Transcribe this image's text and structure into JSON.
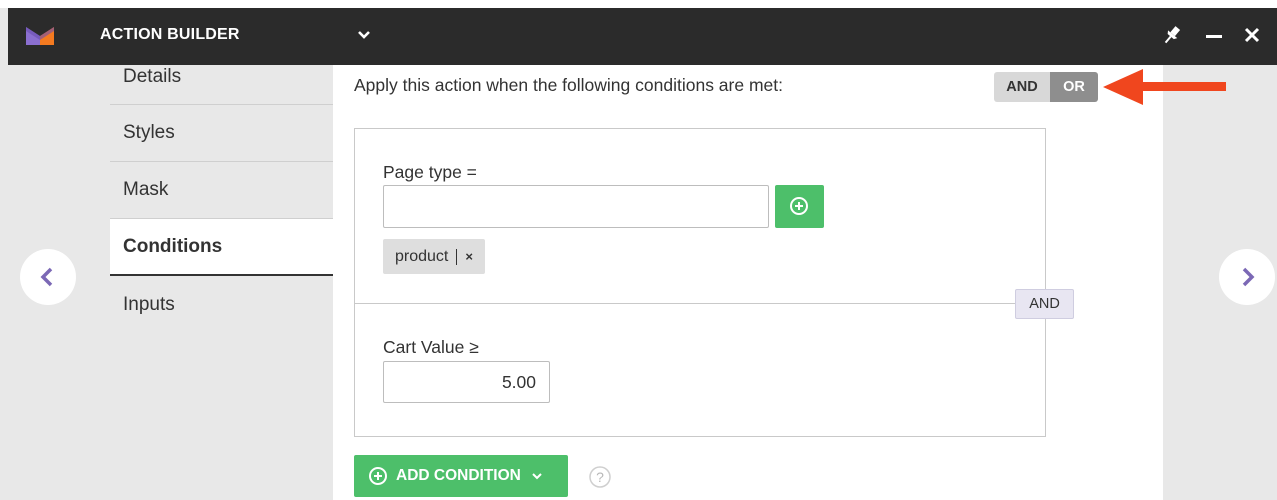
{
  "window": {
    "title": "ACTION BUILDER",
    "brand_color": "#8b6fd0",
    "accent_color": "#f47a20"
  },
  "icons": {
    "logo": "brand-logo",
    "title_menu": "chevron-down-icon",
    "pin": "pin-icon",
    "minimize": "minimize-icon",
    "close": "close-icon",
    "prev": "chevron-left-icon",
    "next": "chevron-right-icon",
    "add": "plus-circle-icon",
    "help": "help-icon"
  },
  "sidebar": {
    "items": [
      {
        "label": "Details",
        "active": false
      },
      {
        "label": "Styles",
        "active": false
      },
      {
        "label": "Mask",
        "active": false
      },
      {
        "label": "Conditions",
        "active": true
      },
      {
        "label": "Inputs",
        "active": false
      }
    ]
  },
  "conditions": {
    "intro": "Apply this action when the following conditions are met:",
    "toggle": {
      "and_label": "AND",
      "or_label": "OR",
      "selected": "OR"
    },
    "connector_label": "AND",
    "page_type": {
      "label": "Page type =",
      "input_value": "",
      "tags": [
        {
          "label": "product",
          "remove": "×"
        }
      ]
    },
    "cart_value": {
      "label": "Cart Value ≥",
      "input_value": "5.00"
    },
    "add_button_label": "ADD CONDITION",
    "help_glyph": "?"
  },
  "colors": {
    "titlebar": "#2b2b2b",
    "green": "#4dbf6a",
    "toggle_on": "#8e8e8e",
    "toggle_off": "#d8d8d8",
    "arrow_purple": "#7b68b5",
    "annotation_arrow": "#f0461e"
  }
}
